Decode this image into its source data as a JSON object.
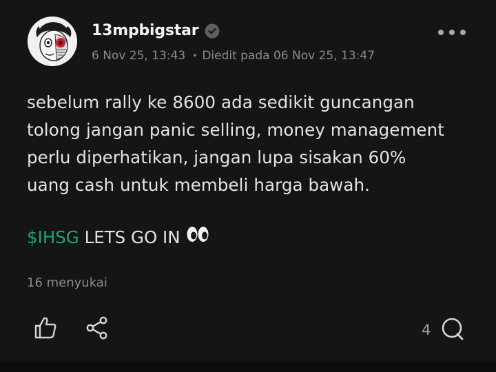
{
  "post": {
    "username": "13mpbigstar",
    "posted_at": "6 Nov 25, 13:43",
    "edited_label": "Diedit pada 06 Nov 25, 13:47",
    "body_lines": [
      "sebelum rally ke 8600 ada sedikit guncangan",
      "tolong jangan panic selling, money management",
      "perlu diperhatikan, jangan lupa sisakan 60%",
      "uang cash untuk membeli harga bawah."
    ],
    "cashtag": "$IHSG",
    "tag_text": " LETS GO IN",
    "emoji": "👀",
    "likes_label": "16 menyukai",
    "comment_count": "4"
  },
  "icons": {
    "verified": "verified-badge-icon",
    "more": "more-options-icon",
    "like": "thumbs-up-icon",
    "share": "share-icon",
    "comment": "comment-bubble-icon"
  },
  "colors": {
    "background": "#151515",
    "text": "#e4e4e4",
    "muted": "#8b8b8b",
    "cashtag": "#1ea672"
  }
}
